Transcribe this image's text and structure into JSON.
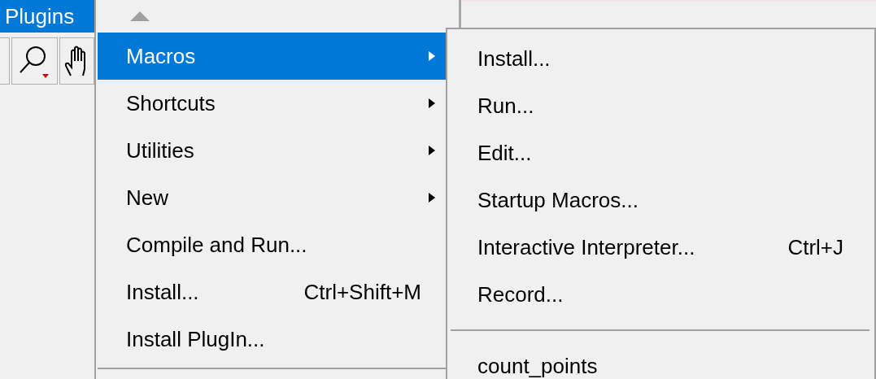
{
  "menu_bar": {
    "label": "Plugins",
    "selected": true
  },
  "menu": {
    "items": [
      {
        "kind": "item",
        "label": "Macros",
        "has_submenu": true,
        "selected": true
      },
      {
        "kind": "item",
        "label": "Shortcuts",
        "has_submenu": true,
        "selected": false
      },
      {
        "kind": "item",
        "label": "Utilities",
        "has_submenu": true,
        "selected": false
      },
      {
        "kind": "item",
        "label": "New",
        "has_submenu": true,
        "selected": false
      },
      {
        "kind": "item",
        "label": "Compile and Run...",
        "has_submenu": false,
        "selected": false
      },
      {
        "kind": "item",
        "label": "Install...",
        "shortcut": "Ctrl+Shift+M",
        "has_submenu": false,
        "selected": false
      },
      {
        "kind": "item",
        "label": "Install PlugIn...",
        "has_submenu": false,
        "selected": false
      },
      {
        "kind": "separator"
      }
    ]
  },
  "submenu": {
    "items": [
      {
        "kind": "item",
        "label": "Install...",
        "selected": false
      },
      {
        "kind": "item",
        "label": "Run...",
        "selected": false
      },
      {
        "kind": "item",
        "label": "Edit...",
        "selected": false
      },
      {
        "kind": "item",
        "label": "Startup Macros...",
        "selected": false
      },
      {
        "kind": "item",
        "label": "Interactive Interpreter...",
        "shortcut": "Ctrl+J",
        "selected": false
      },
      {
        "kind": "item",
        "label": "Record...",
        "selected": false
      },
      {
        "kind": "separator"
      },
      {
        "kind": "item",
        "label": "count_points",
        "selected": false
      }
    ]
  }
}
